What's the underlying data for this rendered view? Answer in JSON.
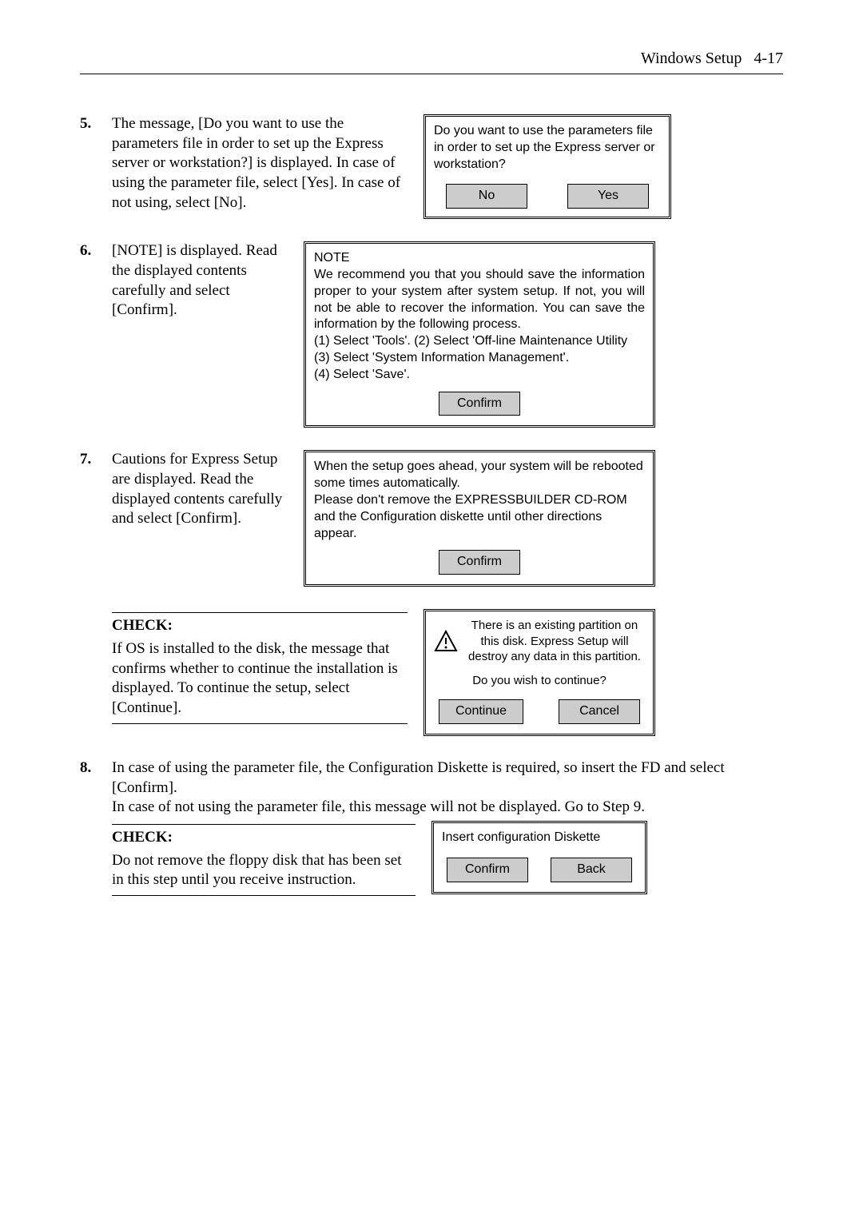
{
  "header": {
    "section": "Windows Setup",
    "page": "4-17"
  },
  "step5": {
    "num": "5.",
    "text": "The message, [Do you want to use the parameters file in order to set up the Express server or workstation?] is displayed. In case of using the parameter file, select [Yes]. In case of not using, select [No].",
    "dialog_text": "Do you want to use the parameters file in order to set up the Express server or workstation?",
    "btn_no": "No",
    "btn_yes": "Yes"
  },
  "step6": {
    "num": "6.",
    "text": "[NOTE] is displayed. Read the displayed contents carefully and select [Confirm].",
    "note_title": "NOTE",
    "note_body": "We recommend you that you should save the information proper to your system after system setup. If not, you will not be able to recover the information. You can save the information by the following process.",
    "note_l1": "(1) Select 'Tools'. (2) Select 'Off-line Maintenance Utility",
    "note_l2": "(3) Select 'System Information Management'.",
    "note_l3": "(4) Select 'Save'.",
    "btn_confirm": "Confirm"
  },
  "step7": {
    "num": "7.",
    "text": "Cautions for Express Setup are displayed. Read the displayed contents carefully and select [Confirm].",
    "dialog_l1": "When the setup goes ahead, your system will be rebooted some times automatically.",
    "dialog_l2": "Please don't remove the EXPRESSBUILDER CD-ROM and the Configuration diskette until other directions appear.",
    "btn_confirm": "Confirm"
  },
  "check1": {
    "title": "CHECK:",
    "text": "If OS is installed to the disk, the message that confirms whether to continue the installation is displayed. To continue the setup, select [Continue].",
    "warn_text": "There is an existing partition on this disk. Express Setup will destroy any data in this partition.",
    "question": "Do you wish to continue?",
    "btn_continue": "Continue",
    "btn_cancel": "Cancel"
  },
  "step8": {
    "num": "8.",
    "text1": "In case of using the parameter file, the Configuration Diskette is required, so insert the FD and select [Confirm].",
    "text2": "In case of not using the parameter file, this message will not be displayed. Go to Step 9."
  },
  "check2": {
    "title": "CHECK:",
    "text": "Do not remove the floppy disk that has been set in this step until you receive instruction.",
    "dialog_text": "Insert configuration Diskette",
    "btn_confirm": "Confirm",
    "btn_back": "Back"
  }
}
